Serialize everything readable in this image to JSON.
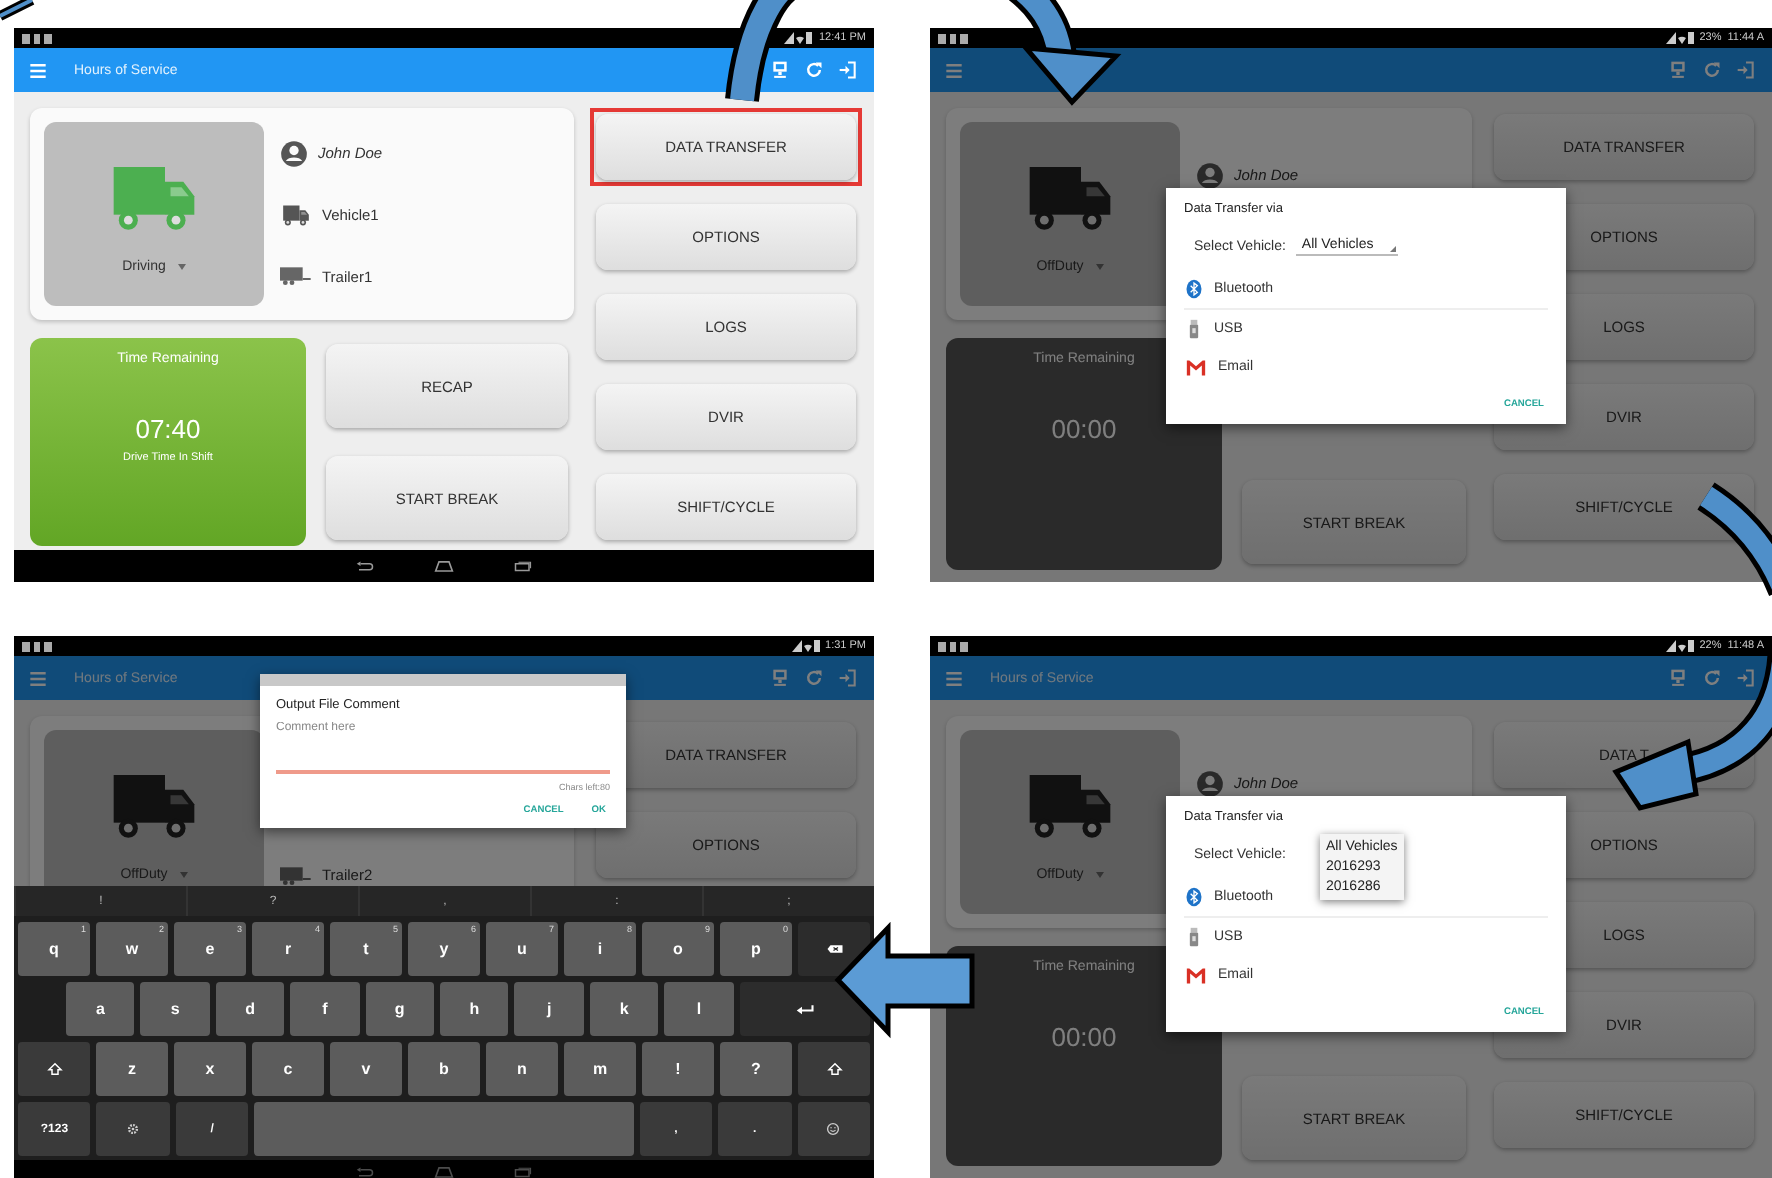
{
  "panels": [
    {
      "status_bar": {
        "time": "12:41 PM"
      },
      "app_bar": {
        "title": "Hours of Service"
      },
      "dimmed": false,
      "nav_bar": true,
      "home": {
        "driving": true,
        "status": "Driving",
        "driver": "John Doe",
        "vehicle": "Vehicle1",
        "trailer": "Trailer1",
        "time_card": {
          "title": "Time Remaining",
          "value": "07:40",
          "caption": "Drive Time In Shift"
        },
        "left_buttons": [
          {
            "label": "RECAP",
            "highlighted": false
          },
          {
            "label": "START BREAK",
            "highlighted": false
          }
        ],
        "right_buttons": [
          {
            "label": "DATA TRANSFER",
            "highlighted": true
          },
          {
            "label": "OPTIONS",
            "highlighted": false
          },
          {
            "label": "LOGS",
            "highlighted": false
          },
          {
            "label": "DVIR",
            "highlighted": false
          },
          {
            "label": "SHIFT/CYCLE",
            "highlighted": false
          }
        ]
      }
    },
    {
      "status_bar": {
        "battery": "23%",
        "time": "11:44 A"
      },
      "dimmed": true,
      "nav_bar": false,
      "home": {
        "driving": false,
        "status": "OffDuty",
        "driver": "John Doe",
        "time_card": {
          "title": "Time Remaining",
          "value": "00:00"
        },
        "left_buttons": [
          {
            "label": "START BREAK",
            "highlighted": false
          }
        ],
        "right_buttons": [
          {
            "label": "DATA TRANSFER",
            "highlighted": false
          },
          {
            "label": "OPTIONS",
            "highlighted": false
          },
          {
            "label": "LOGS",
            "highlighted": false
          },
          {
            "label": "DVIR",
            "highlighted": false
          },
          {
            "label": "SHIFT/CYCLE",
            "highlighted": false
          }
        ]
      },
      "dialog": {
        "kind": "transfer",
        "title": "Data Transfer via",
        "select": {
          "label": "Select Vehicle:",
          "value": "All Vehicles",
          "expanded": false
        },
        "methods": [
          {
            "kind": "bluetooth",
            "label": "Bluetooth"
          },
          {
            "kind": "usb",
            "label": "USB"
          },
          {
            "kind": "email",
            "label": "Email"
          }
        ],
        "buttons": [
          "CANCEL"
        ]
      }
    },
    {
      "status_bar": {
        "time": "1:31 PM"
      },
      "app_bar": {
        "title": "Hours of Service"
      },
      "dimmed": true,
      "nav_bar": true,
      "home": {
        "driving": false,
        "status": "OffDuty",
        "trailer": "Trailer2",
        "right_buttons": [
          {
            "label": "DATA TRANSFER",
            "highlighted": false
          },
          {
            "label": "OPTIONS",
            "highlighted": false
          }
        ]
      },
      "dialog": {
        "kind": "comment",
        "title": "Output File Comment",
        "input": {
          "placeholder": "Comment here",
          "focused": true
        },
        "counter": "Chars left:80",
        "buttons": [
          "CANCEL",
          "OK"
        ]
      },
      "keyboard": {
        "suggestions": [
          "!",
          "?",
          ",",
          ":",
          ";"
        ],
        "rows": [
          {
            "keys": [
              {
                "kind": "char",
                "label": "q",
                "hint": "1"
              },
              {
                "kind": "char",
                "label": "w",
                "hint": "2"
              },
              {
                "kind": "char",
                "label": "e",
                "hint": "3"
              },
              {
                "kind": "char",
                "label": "r",
                "hint": "4"
              },
              {
                "kind": "char",
                "label": "t",
                "hint": "5"
              },
              {
                "kind": "char",
                "label": "y",
                "hint": "6"
              },
              {
                "kind": "char",
                "label": "u",
                "hint": "7"
              },
              {
                "kind": "char",
                "label": "i",
                "hint": "8"
              },
              {
                "kind": "char",
                "label": "o",
                "hint": "9"
              },
              {
                "kind": "char",
                "label": "p",
                "hint": "0"
              },
              {
                "kind": "backspace"
              }
            ]
          },
          {
            "keys": [
              {
                "kind": "char",
                "label": "a"
              },
              {
                "kind": "char",
                "label": "s"
              },
              {
                "kind": "char",
                "label": "d"
              },
              {
                "kind": "char",
                "label": "f"
              },
              {
                "kind": "char",
                "label": "g"
              },
              {
                "kind": "char",
                "label": "h"
              },
              {
                "kind": "char",
                "label": "j"
              },
              {
                "kind": "char",
                "label": "k"
              },
              {
                "kind": "char",
                "label": "l"
              },
              {
                "kind": "enter"
              }
            ]
          },
          {
            "keys": [
              {
                "kind": "shift"
              },
              {
                "kind": "char",
                "label": "z"
              },
              {
                "kind": "char",
                "label": "x"
              },
              {
                "kind": "char",
                "label": "c"
              },
              {
                "kind": "char",
                "label": "v"
              },
              {
                "kind": "char",
                "label": "b"
              },
              {
                "kind": "char",
                "label": "n"
              },
              {
                "kind": "char",
                "label": "m"
              },
              {
                "kind": "char",
                "label": "!"
              },
              {
                "kind": "char",
                "label": "?"
              },
              {
                "kind": "shift"
              }
            ]
          },
          {
            "keys": [
              {
                "kind": "fn",
                "label": "?123"
              },
              {
                "kind": "settings"
              },
              {
                "kind": "fn",
                "label": "/"
              },
              {
                "kind": "space"
              },
              {
                "kind": "fn",
                "label": ","
              },
              {
                "kind": "fn",
                "label": "."
              },
              {
                "kind": "emoji"
              }
            ]
          }
        ]
      }
    },
    {
      "status_bar": {
        "battery": "22%",
        "time": "11:48 A"
      },
      "app_bar": {
        "title": "Hours of Service"
      },
      "dimmed": true,
      "nav_bar": false,
      "home": {
        "driving": false,
        "status": "OffDuty",
        "driver": "John Doe",
        "time_card": {
          "title": "Time Remaining",
          "value": "00:00"
        },
        "left_buttons": [
          {
            "label": "START BREAK",
            "highlighted": false
          }
        ],
        "right_buttons": [
          {
            "label": "DATA T",
            "highlighted": false
          },
          {
            "label": "OPTIONS",
            "highlighted": false
          },
          {
            "label": "LOGS",
            "highlighted": false
          },
          {
            "label": "DVIR",
            "highlighted": false
          },
          {
            "label": "SHIFT/CYCLE",
            "highlighted": false
          }
        ]
      },
      "dialog": {
        "kind": "transfer",
        "title": "Data Transfer via",
        "select": {
          "label": "Select Vehicle:",
          "expanded": true,
          "options": [
            "All Vehicles",
            "2016293",
            "2016286"
          ]
        },
        "methods": [
          {
            "kind": "bluetooth",
            "label": "Bluetooth"
          },
          {
            "kind": "usb",
            "label": "USB"
          },
          {
            "kind": "email",
            "label": "Email"
          }
        ],
        "buttons": [
          "CANCEL"
        ]
      }
    }
  ]
}
